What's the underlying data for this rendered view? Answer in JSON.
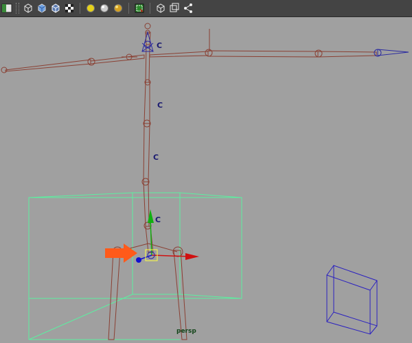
{
  "toolbar": {
    "items": [
      {
        "name": "layout-icon",
        "kind": "icon"
      },
      {
        "name": "grip",
        "kind": "grip"
      },
      {
        "name": "wireframe-cube-icon",
        "kind": "icon"
      },
      {
        "name": "smooth-shade-cube-icon",
        "kind": "icon"
      },
      {
        "name": "wire-on-shaded-cube-icon",
        "kind": "icon"
      },
      {
        "name": "texture-checker-icon",
        "kind": "icon"
      },
      {
        "name": "sep",
        "kind": "sep"
      },
      {
        "name": "default-light-icon",
        "kind": "icon"
      },
      {
        "name": "all-lights-icon",
        "kind": "icon"
      },
      {
        "name": "shadows-light-icon",
        "kind": "icon"
      },
      {
        "name": "sep",
        "kind": "sep"
      },
      {
        "name": "select-camera-icon",
        "kind": "icon"
      },
      {
        "name": "sep",
        "kind": "sep"
      },
      {
        "name": "isolate-select-icon",
        "kind": "icon"
      },
      {
        "name": "xray-icon",
        "kind": "icon"
      },
      {
        "name": "share-icon",
        "kind": "icon"
      }
    ]
  },
  "viewport": {
    "camera_label": "persp",
    "control_labels": [
      "C",
      "C",
      "C",
      "C"
    ],
    "colors": {
      "background": "#a0a0a0",
      "joint": "#8a3f32",
      "selected_joint": "#2a2aa0",
      "bounding_box": "#5bf0a0",
      "axis_x": "#d01010",
      "axis_y": "#10b010",
      "axis_z": "#1010d0",
      "pointer_arrow": "#ff5a1a",
      "gate": "#2a20c0"
    }
  }
}
